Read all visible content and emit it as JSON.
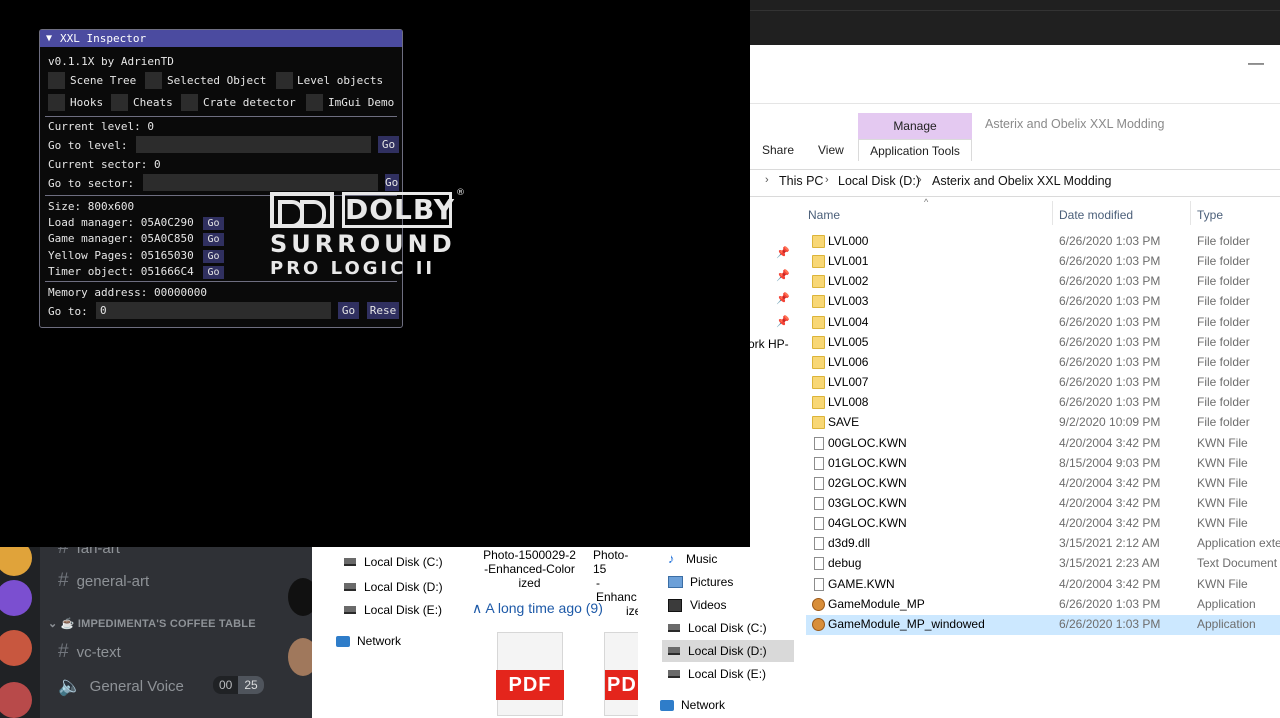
{
  "imgui": {
    "title": "XXL Inspector",
    "version": "v0.1.1X by AdrienTD",
    "checkboxes": [
      "Scene Tree",
      "Selected Object",
      "Level objects",
      "Hooks",
      "Cheats",
      "Crate detector",
      "ImGui Demo"
    ],
    "current_level": "Current level: 0",
    "goto_level_label": "Go to level:",
    "current_sector": "Current sector: 0",
    "goto_sector_label": "Go to sector:",
    "go": "Go",
    "size": "Size: 800x600",
    "managers": [
      {
        "label": "Load manager: 05A0C290"
      },
      {
        "label": "Game manager: 05A0C850"
      },
      {
        "label": "Yellow Pages: 05165030"
      },
      {
        "label": "Timer object: 051666C4"
      }
    ],
    "memory_address": "Memory address: 00000000",
    "goto_label": "Go to:",
    "goto_value": "0",
    "reset": "Rese"
  },
  "dolby": {
    "name": "DOLBY",
    "line1": "SURROUND",
    "line2": "PRO LOGIC II",
    "reg": "®"
  },
  "explorer": {
    "minimize": "—",
    "context_group": "Manage",
    "context_tab": "Application Tools",
    "window_title": "Asterix and Obelix XXL Modding",
    "tabs": [
      "Share",
      "View"
    ],
    "breadcrumb": [
      "This PC",
      "Local Disk (D:)",
      "Asterix and Obelix XXL Modding"
    ],
    "columns": [
      "Name",
      "Date modified",
      "Type"
    ],
    "partial_nav": "ork HP-",
    "files": [
      {
        "name": "LVL000",
        "date": "6/26/2020 1:03 PM",
        "type": "File folder",
        "kind": "folder"
      },
      {
        "name": "LVL001",
        "date": "6/26/2020 1:03 PM",
        "type": "File folder",
        "kind": "folder"
      },
      {
        "name": "LVL002",
        "date": "6/26/2020 1:03 PM",
        "type": "File folder",
        "kind": "folder"
      },
      {
        "name": "LVL003",
        "date": "6/26/2020 1:03 PM",
        "type": "File folder",
        "kind": "folder"
      },
      {
        "name": "LVL004",
        "date": "6/26/2020 1:03 PM",
        "type": "File folder",
        "kind": "folder"
      },
      {
        "name": "LVL005",
        "date": "6/26/2020 1:03 PM",
        "type": "File folder",
        "kind": "folder"
      },
      {
        "name": "LVL006",
        "date": "6/26/2020 1:03 PM",
        "type": "File folder",
        "kind": "folder"
      },
      {
        "name": "LVL007",
        "date": "6/26/2020 1:03 PM",
        "type": "File folder",
        "kind": "folder"
      },
      {
        "name": "LVL008",
        "date": "6/26/2020 1:03 PM",
        "type": "File folder",
        "kind": "folder"
      },
      {
        "name": "SAVE",
        "date": "9/2/2020 10:09 PM",
        "type": "File folder",
        "kind": "folder"
      },
      {
        "name": "00GLOC.KWN",
        "date": "4/20/2004 3:42 PM",
        "type": "KWN File",
        "kind": "file"
      },
      {
        "name": "01GLOC.KWN",
        "date": "8/15/2004 9:03 PM",
        "type": "KWN File",
        "kind": "file"
      },
      {
        "name": "02GLOC.KWN",
        "date": "4/20/2004 3:42 PM",
        "type": "KWN File",
        "kind": "file"
      },
      {
        "name": "03GLOC.KWN",
        "date": "4/20/2004 3:42 PM",
        "type": "KWN File",
        "kind": "file"
      },
      {
        "name": "04GLOC.KWN",
        "date": "4/20/2004 3:42 PM",
        "type": "KWN File",
        "kind": "file"
      },
      {
        "name": "d3d9.dll",
        "date": "3/15/2021 2:12 AM",
        "type": "Application exte",
        "kind": "file"
      },
      {
        "name": "debug",
        "date": "3/15/2021 2:23 AM",
        "type": "Text Document",
        "kind": "file"
      },
      {
        "name": "GAME.KWN",
        "date": "4/20/2004 3:42 PM",
        "type": "KWN File",
        "kind": "file"
      },
      {
        "name": "GameModule_MP",
        "date": "6/26/2020 1:03 PM",
        "type": "Application",
        "kind": "app"
      },
      {
        "name": "GameModule_MP_windowed",
        "date": "6/26/2020 1:03 PM",
        "type": "Application",
        "kind": "app",
        "selected": true
      }
    ],
    "nav_lower": [
      {
        "label": "Music",
        "icon": "music-icon"
      },
      {
        "label": "Pictures",
        "icon": "pictures-icon"
      },
      {
        "label": "Videos",
        "icon": "videos-icon"
      },
      {
        "label": "Local Disk (C:)",
        "icon": "drive-icon"
      },
      {
        "label": "Local Disk (D:)",
        "icon": "drive-icon",
        "selected": true
      },
      {
        "label": "Local Disk (E:)",
        "icon": "drive-icon"
      },
      {
        "label": "Network",
        "icon": "network-icon"
      }
    ]
  },
  "explorer2": {
    "nav": [
      "Local Disk (C:)",
      "Local Disk (D:)",
      "Local Disk (E:)",
      "Network"
    ],
    "thumb1": "Photo-1500029-2 -Enhanced-Color ized",
    "thumb1_lines": [
      "Photo-1500029-2",
      "-Enhanced-Color",
      "ized"
    ],
    "thumb2_lines": [
      "Photo-15",
      "-Enhanc",
      "ize"
    ],
    "group": "A long time ago (9)",
    "pdf": "PDF",
    "pdf_partial": "PD"
  },
  "discord": {
    "channels": [
      "fan-art",
      "general-art",
      "vc-text",
      "General Voice"
    ],
    "category": "IMPEDIMENTA'S COFFEE TABLE",
    "voice_count_a": "00",
    "voice_count_b": "25",
    "hash": "#"
  }
}
